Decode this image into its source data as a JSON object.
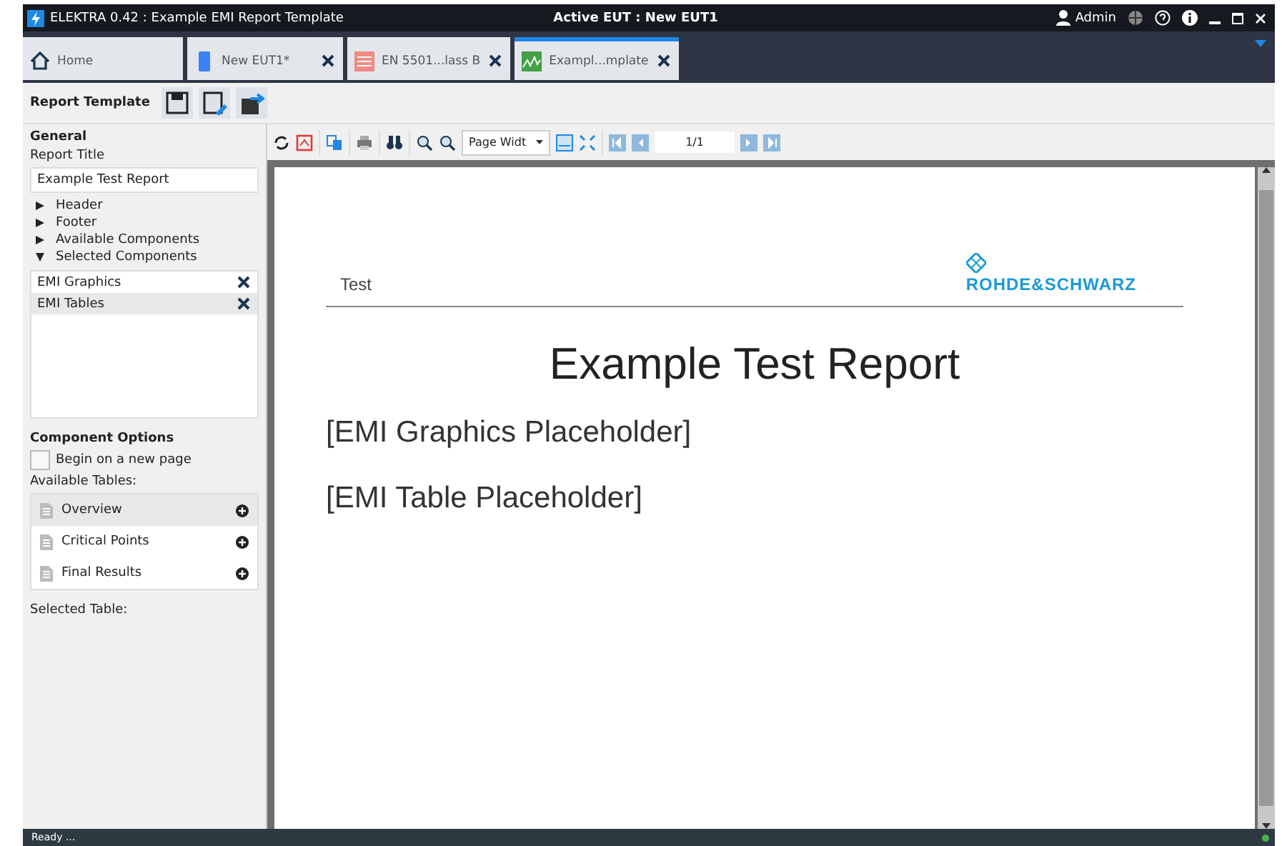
{
  "window": {
    "title": "ELEKTRA 0.42 : Example EMI Report Template",
    "active_eut": "Active EUT : New EUT1",
    "user": "Admin"
  },
  "tabs": [
    {
      "label": "Home",
      "kind": "home",
      "selected": false
    },
    {
      "label": "New EUT1*",
      "kind": "eut",
      "selected": false
    },
    {
      "label": "EN 5501...lass B",
      "kind": "limit",
      "selected": false
    },
    {
      "label": "Exampl...mplate",
      "kind": "report",
      "selected": true
    }
  ],
  "toolbar": {
    "title": "Report Template"
  },
  "sidebar": {
    "general_heading": "General",
    "report_title_label": "Report Title",
    "report_title_value": "Example Test Report",
    "tree": [
      {
        "label": "Header",
        "expanded": false
      },
      {
        "label": "Footer",
        "expanded": false
      },
      {
        "label": "Available Components",
        "expanded": false
      },
      {
        "label": "Selected Components",
        "expanded": true
      }
    ],
    "selected_components": [
      {
        "label": "EMI Graphics",
        "selected": false
      },
      {
        "label": "EMI Tables",
        "selected": true
      }
    ],
    "options_heading": "Component Options",
    "begin_new_page": {
      "label": "Begin on a new page",
      "checked": false
    },
    "available_tables_label": "Available Tables:",
    "available_tables": [
      {
        "label": "Overview",
        "selected": true
      },
      {
        "label": "Critical Points",
        "selected": false
      },
      {
        "label": "Final Results",
        "selected": false
      }
    ],
    "selected_table_label": "Selected Table:"
  },
  "viewer": {
    "zoom": "Page Widt",
    "page": "1/1"
  },
  "document": {
    "header_text": "Test",
    "logo": "ROHDE&SCHWARZ",
    "title": "Example Test Report",
    "paragraphs": [
      "[EMI Graphics Placeholder]",
      "[EMI Table Placeholder]"
    ]
  },
  "status_bar": {
    "text": "Ready ..."
  }
}
